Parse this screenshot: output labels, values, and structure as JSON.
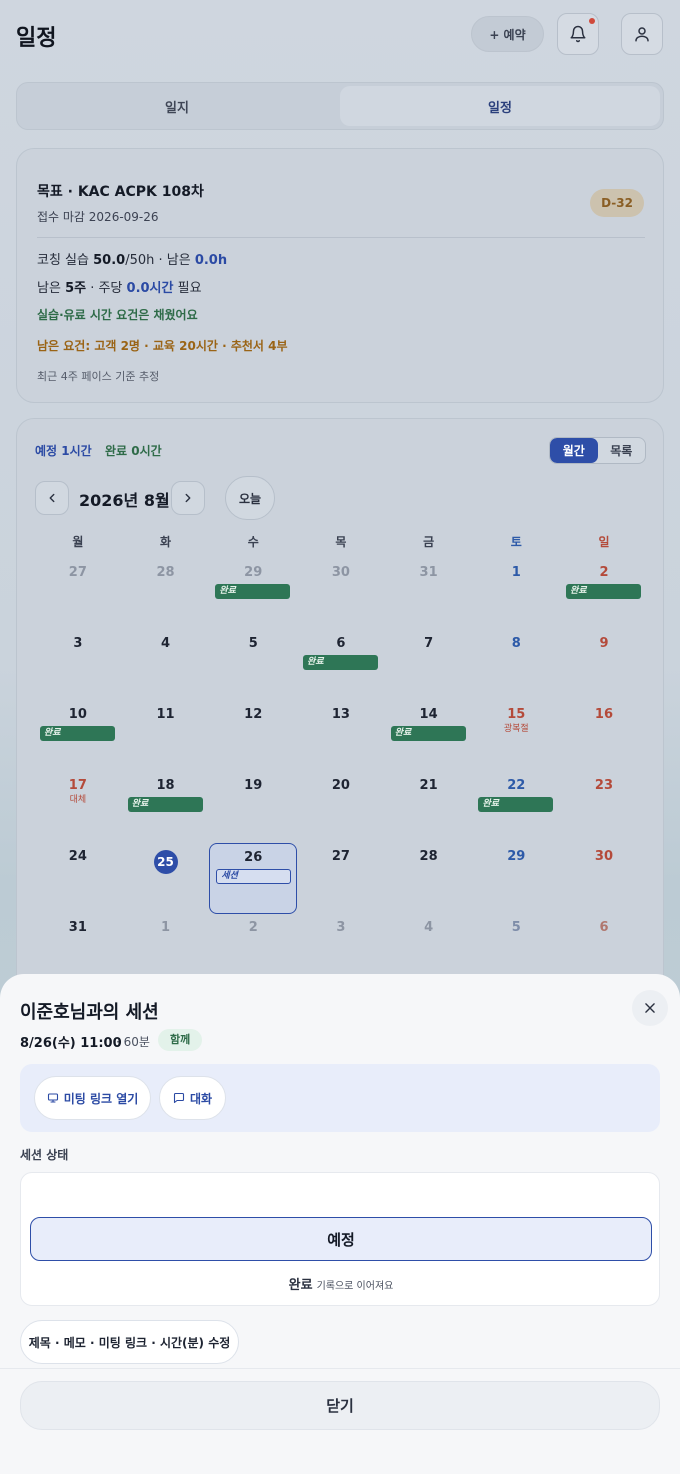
{
  "header": {
    "title": "일정",
    "reserve_label": "+ 예약"
  },
  "tabs": [
    {
      "label": "일지",
      "active": false
    },
    {
      "label": "일정",
      "active": true
    }
  ],
  "goal": {
    "title": "목표 · KAC ACPK 108차",
    "deadline": "접수 마감 2026-09-26",
    "dday": "D-32",
    "coaching_prefix": "코칭 실습 ",
    "coaching_done": "50.0",
    "coaching_mid": "/50h · 남은 ",
    "coaching_left": "0.0h",
    "weeks_prefix": "남은 ",
    "weeks": "5주",
    "weeks_mid": " · 주당 ",
    "per_week": "0.0시간",
    "weeks_suffix": " 필요",
    "met": "실습·유료 시간 요건은 채웠어요",
    "remaining": "남은 요건: 고객 2명 · 교육 20시간 · 추천서 4부",
    "note": "최근 4주 페이스 기준 추정"
  },
  "calendar": {
    "planned": "예정 1시간",
    "done": "완료 0시간",
    "view_month": "월간",
    "view_list": "목록",
    "month_label": "2026년 8월",
    "today_label": "오늘",
    "weekdays": [
      "월",
      "화",
      "수",
      "목",
      "금",
      "토",
      "일"
    ],
    "weeks": [
      [
        {
          "d": "27",
          "o": true
        },
        {
          "d": "28",
          "o": true
        },
        {
          "d": "29",
          "o": true,
          "ev": "완료"
        },
        {
          "d": "30",
          "o": true
        },
        {
          "d": "31",
          "o": true
        },
        {
          "d": "1"
        },
        {
          "d": "2",
          "ev": "완료"
        }
      ],
      [
        {
          "d": "3"
        },
        {
          "d": "4"
        },
        {
          "d": "5"
        },
        {
          "d": "6",
          "ev": "완료"
        },
        {
          "d": "7"
        },
        {
          "d": "8"
        },
        {
          "d": "9"
        }
      ],
      [
        {
          "d": "10",
          "ev": "완료"
        },
        {
          "d": "11"
        },
        {
          "d": "12"
        },
        {
          "d": "13"
        },
        {
          "d": "14",
          "ev": "완료"
        },
        {
          "d": "15",
          "hol": "광복절"
        },
        {
          "d": "16"
        }
      ],
      [
        {
          "d": "17",
          "hol": "대체"
        },
        {
          "d": "18",
          "ev": "완료"
        },
        {
          "d": "19"
        },
        {
          "d": "20"
        },
        {
          "d": "21"
        },
        {
          "d": "22",
          "ev": "완료"
        },
        {
          "d": "23"
        }
      ],
      [
        {
          "d": "24"
        },
        {
          "d": "25",
          "today": true
        },
        {
          "d": "26",
          "ev": "세션",
          "sel": true
        },
        {
          "d": "27"
        },
        {
          "d": "28"
        },
        {
          "d": "29"
        },
        {
          "d": "30"
        }
      ],
      [
        {
          "d": "31"
        },
        {
          "d": "1",
          "o": true
        },
        {
          "d": "2",
          "o": true
        },
        {
          "d": "3",
          "o": true
        },
        {
          "d": "4",
          "o": true
        },
        {
          "d": "5",
          "o": true
        },
        {
          "d": "6",
          "o": true
        }
      ]
    ]
  },
  "sheet": {
    "title": "이준호님과의 세션",
    "when": "8/26(수) 11:00",
    "duration": "· 60분",
    "badge": "함께",
    "meet_link": "미팅 링크 열기",
    "chat": "대화",
    "status_label": "세션 상태",
    "status_current": "예정",
    "status_done": "완료",
    "status_done_note": "기록으로 이어져요",
    "edit_label": "제목 · 메모 · 미팅 링크 · 시간(분) 수정",
    "close_label": "닫기"
  },
  "colors": {
    "accent": "#2e4ea8",
    "done_event": "#2e7656",
    "saturday": "#2d5aa8",
    "sunday": "#b44a3a"
  }
}
